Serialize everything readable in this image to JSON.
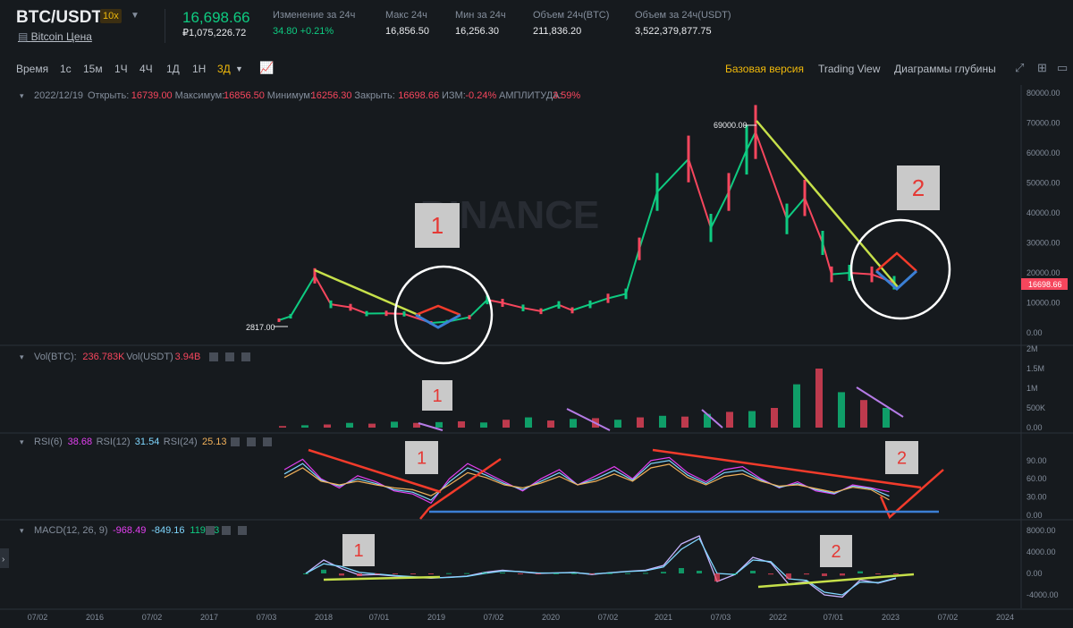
{
  "header": {
    "pair": "BTC/USDT",
    "leverage": "10x",
    "subtitle": "Bitcoin Цена",
    "last_price": "16,698.66",
    "last_price_fiat": "₽1,075,226.72",
    "stats": [
      {
        "label": "Изменение за 24ч",
        "value": "34.80 +0.21%"
      },
      {
        "label": "Макс 24ч",
        "value": "16,856.50"
      },
      {
        "label": "Мин за 24ч",
        "value": "16,256.30"
      },
      {
        "label": "Объем 24ч(BTC)",
        "value": "211,836.20"
      },
      {
        "label": "Объем за 24ч(USDT)",
        "value": "3,522,379,877.75"
      }
    ]
  },
  "toolbar": {
    "timeframes": [
      "Время",
      "1с",
      "15м",
      "1Ч",
      "4Ч",
      "1Д",
      "1Н",
      "3Д"
    ],
    "active_timeframe": "3Д",
    "versions": [
      "Базовая версия",
      "Trading View",
      "Диаграммы глубины"
    ],
    "active_version": "Базовая версия"
  },
  "legends": {
    "candle": {
      "date": "2022/12/19",
      "open_label": "Открыть:",
      "open": "16739.00",
      "high_label": "Максимум:",
      "high": "16856.50",
      "low_label": "Минимум:",
      "low": "16256.30",
      "close_label": "Закрыть:",
      "close": "16698.66",
      "chg_label": "ИЗМ:",
      "chg": "-0.24%",
      "amp_label": "АМПЛИТУДА:",
      "amp": "3.59%"
    },
    "vol": {
      "a_label": "Vol(BTC):",
      "a": "236.783K",
      "b_label": "Vol(USDT)",
      "b": "3.94B"
    },
    "rsi": {
      "r6_label": "RSI(6)",
      "r6": "38.68",
      "r12_label": "RSI(12)",
      "r12": "31.54",
      "r24_label": "RSI(24)",
      "r24": "25.13"
    },
    "macd": {
      "label": "MACD(12, 26, 9)",
      "macd": "-968.49",
      "signal": "-849.16",
      "hist": "119.33"
    }
  },
  "annotations": {
    "price_low": "2817.00",
    "price_high": "69000.00",
    "price_tag": "16698.66",
    "watermark": "BINANCE",
    "box_labels": [
      "1",
      "2"
    ]
  },
  "colors": {
    "up": "#0ecb81",
    "down": "#f6465d",
    "accent": "#f0b90b",
    "trend_green": "#c6e04a",
    "trend_red": "#f23b2b",
    "trend_blue": "#3b7fd4",
    "purple": "#b57be6",
    "rsi6": "#e23ff0",
    "rsi12": "#7fd7ff",
    "rsi24": "#f0b05a"
  },
  "chart_data": [
    {
      "type": "line",
      "title": "BTC/USDT 3Д",
      "x": [
        "2017-08",
        "2017-10",
        "2017-12",
        "2018-02",
        "2018-04",
        "2018-06",
        "2018-08",
        "2018-10",
        "2018-12",
        "2019-02",
        "2019-04",
        "2019-06",
        "2019-08",
        "2019-10",
        "2019-12",
        "2020-02",
        "2020-04",
        "2020-06",
        "2020-08",
        "2020-10",
        "2020-12",
        "2021-02",
        "2021-04",
        "2021-06",
        "2021-08",
        "2021-10",
        "2021-11",
        "2022-01",
        "2022-03",
        "2022-05",
        "2022-06",
        "2022-08",
        "2022-10",
        "2022-12"
      ],
      "series": [
        {
          "name": "",
          "values": [
            4200,
            5500,
            19000,
            9500,
            8500,
            6400,
            6500,
            6300,
            3300,
            3700,
            5200,
            11000,
            10000,
            8300,
            7200,
            9300,
            7500,
            9500,
            11500,
            13000,
            28000,
            47000,
            58000,
            35000,
            47000,
            61000,
            67000,
            38000,
            45000,
            30000,
            19500,
            20000,
            19500,
            16700
          ]
        }
      ],
      "ylim": [
        -3000,
        80000
      ],
      "yticks": [
        "0.00",
        "10000.00",
        "20000.00",
        "30000.00",
        "40000.00",
        "50000.00",
        "60000.00",
        "70000.00",
        "80000.00"
      ],
      "xticks": [
        "07/02",
        "2016",
        "07/02",
        "2017",
        "07/03",
        "2018",
        "07/01",
        "2019",
        "07/02",
        "2020",
        "07/02",
        "2021",
        "07/03",
        "2022",
        "07/01",
        "2023",
        "07/02",
        "2024"
      ]
    },
    {
      "type": "bar",
      "title": "Vol",
      "yticks": [
        "0.00",
        "500K",
        "1M",
        "1.5M",
        "2M"
      ],
      "ylim": [
        0,
        2000000
      ],
      "values": [
        40000,
        60000,
        80000,
        120000,
        100000,
        150000,
        120000,
        140000,
        160000,
        130000,
        200000,
        260000,
        180000,
        220000,
        240000,
        200000,
        260000,
        300000,
        280000,
        350000,
        400000,
        420000,
        500000,
        1100000,
        1500000,
        900000,
        700000,
        500000
      ]
    },
    {
      "type": "line",
      "title": "RSI",
      "yticks": [
        "0.00",
        "30.00",
        "60.00",
        "90.00"
      ],
      "ylim": [
        0,
        100
      ],
      "series": [
        {
          "name": "RSI(6)",
          "values": [
            75,
            92,
            60,
            45,
            65,
            55,
            40,
            35,
            20,
            60,
            85,
            70,
            55,
            40,
            60,
            75,
            50,
            65,
            80,
            60,
            90,
            95,
            70,
            55,
            75,
            80,
            60,
            45,
            55,
            40,
            35,
            50,
            45,
            38.68
          ]
        },
        {
          "name": "RSI(12)",
          "values": [
            68,
            85,
            58,
            48,
            60,
            52,
            42,
            38,
            25,
            55,
            78,
            66,
            52,
            42,
            56,
            70,
            50,
            60,
            74,
            58,
            85,
            90,
            66,
            52,
            70,
            74,
            58,
            46,
            52,
            42,
            36,
            48,
            44,
            31.54
          ]
        },
        {
          "name": "RSI(24)",
          "values": [
            62,
            78,
            56,
            50,
            56,
            50,
            45,
            42,
            32,
            50,
            70,
            62,
            50,
            45,
            53,
            64,
            50,
            56,
            68,
            56,
            78,
            84,
            62,
            50,
            64,
            68,
            56,
            48,
            50,
            44,
            38,
            46,
            42,
            25.13
          ]
        }
      ]
    },
    {
      "type": "line",
      "title": "MACD",
      "yticks": [
        "-4000.00",
        "0.00",
        "4000.00",
        "8000.00"
      ],
      "ylim": [
        -5200,
        8500
      ],
      "series": [
        {
          "name": "MACD",
          "values": [
            0,
            2500,
            900,
            -300,
            -200,
            -500,
            -700,
            -900,
            -700,
            -500,
            200,
            600,
            300,
            0,
            100,
            200,
            -200,
            150,
            400,
            600,
            1500,
            5500,
            7000,
            -1500,
            -200,
            3000,
            2000,
            -2000,
            -1500,
            -4000,
            -4400,
            -1200,
            -1800,
            -968.49
          ]
        },
        {
          "name": "Signal",
          "values": [
            0,
            1800,
            1300,
            200,
            -100,
            -400,
            -600,
            -800,
            -750,
            -550,
            0,
            450,
            350,
            80,
            80,
            150,
            -100,
            100,
            350,
            500,
            1200,
            4500,
            6500,
            0,
            -200,
            2500,
            2200,
            -1000,
            -1300,
            -3500,
            -4000,
            -1600,
            -1700,
            -849.16
          ]
        }
      ]
    }
  ]
}
